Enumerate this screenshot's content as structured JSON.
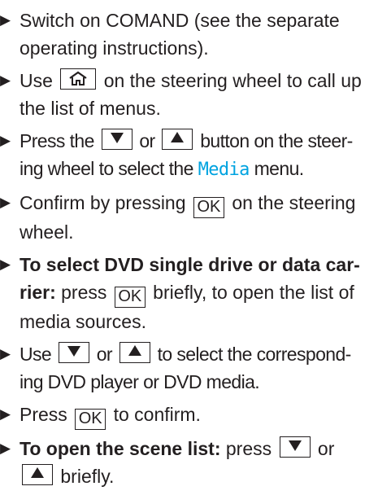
{
  "icons": {
    "bullet": "triangle-right-icon",
    "home": "home-icon",
    "down": "arrow-down-icon",
    "up": "arrow-up-icon"
  },
  "colors": {
    "media_highlight": "#00a3e0",
    "text": "#231f20"
  },
  "steps": {
    "s1": {
      "text_a": "Switch on COMAND (see the separate",
      "text_b": "operating instructions)."
    },
    "s2": {
      "pre": "Use",
      "post_a": "on the steering wheel to call up",
      "post_b": "the list of menus."
    },
    "s3": {
      "pre": "Press the",
      "mid": "or",
      "post_a": "button on the steer-",
      "post_b": "ing wheel to select the",
      "media": "Media",
      "post_c": "menu."
    },
    "s4": {
      "pre": "Confirm by pressing",
      "key": "OK",
      "post_a": "on the steering",
      "post_b": "wheel."
    },
    "s5": {
      "bold_a": "To select DVD single drive or data car-",
      "bold_b": "rier:",
      "pre": "press",
      "key": "OK",
      "post_a": "briefly, to open the list of",
      "post_b": "media sources."
    },
    "s6": {
      "pre": "Use",
      "mid": "or",
      "post_a": "to select the correspond-",
      "post_b": "ing DVD player or DVD media."
    },
    "s7": {
      "pre": "Press",
      "key": "OK",
      "post": "to confirm."
    },
    "s8": {
      "bold": "To open the scene list:",
      "pre": "press",
      "mid": "or",
      "post": "briefly."
    }
  }
}
